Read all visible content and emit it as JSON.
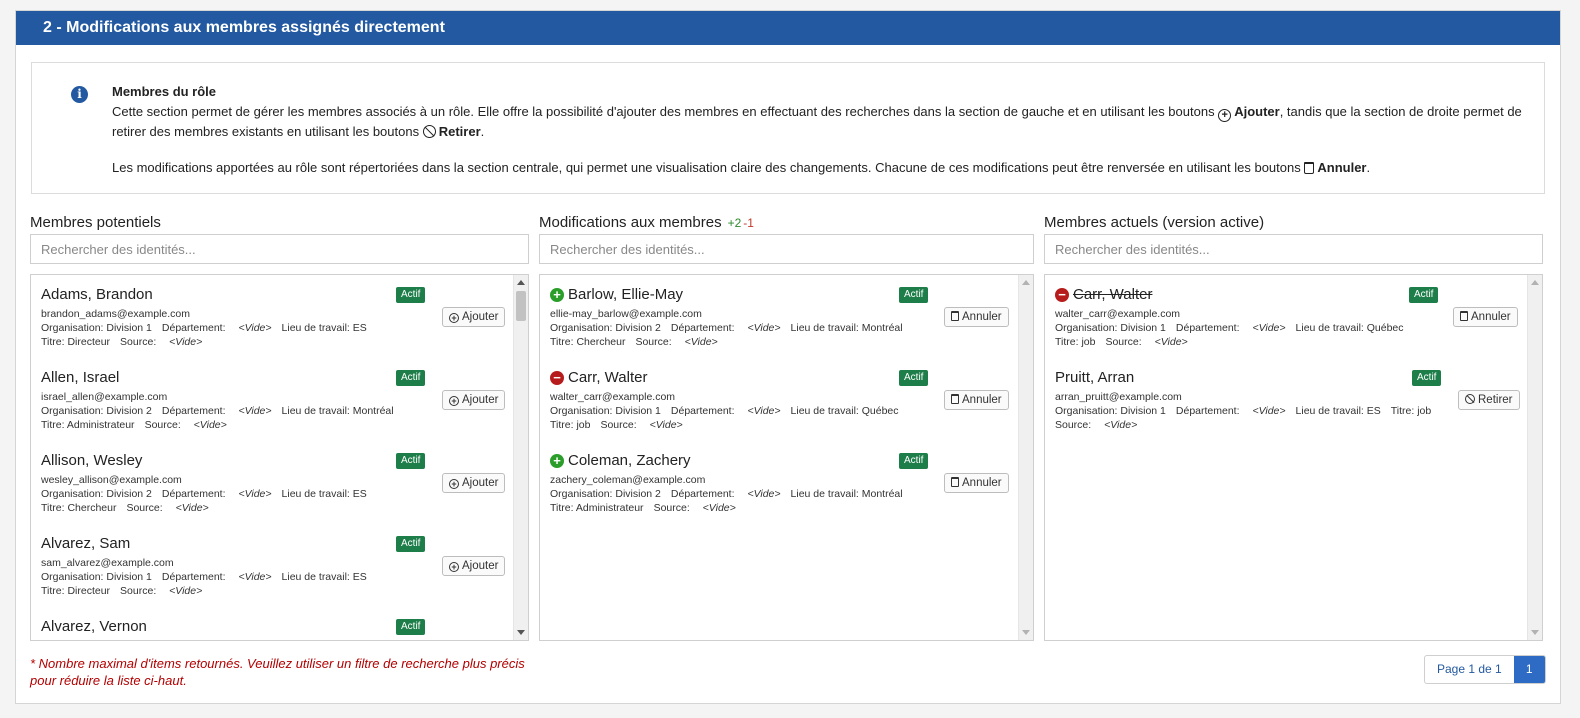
{
  "section": {
    "title": "2 - Modifications aux membres assignés directement"
  },
  "info": {
    "icon": "info-circle-icon",
    "title": "Membres du rôle",
    "p1_a": "Cette section permet de gérer les membres associés à un rôle. Elle offre la possibilité d'ajouter des membres en effectuant des recherches dans la section de gauche et en utilisant les boutons",
    "p1_add": "Ajouter",
    "p1_b": ", tandis que la section de droite permet de retirer des membres existants en utilisant les boutons",
    "p1_remove": "Retirer",
    "p1_c": ".",
    "p2_a": "Les modifications apportées au rôle sont répertoriées dans la section centrale, qui permet une visualisation claire des changements. Chacune de ces modifications peut être renversée en utilisant les boutons",
    "p2_cancel": "Annuler",
    "p2_b": "."
  },
  "columns": {
    "potential": {
      "title": "Membres potentiels",
      "search_placeholder": "Rechercher des identités...",
      "items": [
        {
          "name": "Adams, Brandon",
          "status": "Actif",
          "email": "brandon_adams@example.com",
          "org": "Organisation: Division 1",
          "dept": "Département:",
          "dept_val": "<Vide>",
          "place": "Lieu de travail: ES",
          "title": "Titre: Directeur",
          "source": "Source:",
          "source_val": "<Vide>",
          "button": "Ajouter"
        },
        {
          "name": "Allen, Israel",
          "status": "Actif",
          "email": "israel_allen@example.com",
          "org": "Organisation: Division 2",
          "dept": "Département:",
          "dept_val": "<Vide>",
          "place": "Lieu de travail: Montréal",
          "title": "Titre: Administrateur",
          "source": "Source:",
          "source_val": "<Vide>",
          "button": "Ajouter"
        },
        {
          "name": "Allison, Wesley",
          "status": "Actif",
          "email": "wesley_allison@example.com",
          "org": "Organisation: Division 2",
          "dept": "Département:",
          "dept_val": "<Vide>",
          "place": "Lieu de travail: ES",
          "title": "Titre: Chercheur",
          "source": "Source:",
          "source_val": "<Vide>",
          "button": "Ajouter"
        },
        {
          "name": "Alvarez, Sam",
          "status": "Actif",
          "email": "sam_alvarez@example.com",
          "org": "Organisation: Division 1",
          "dept": "Département:",
          "dept_val": "<Vide>",
          "place": "Lieu de travail: ES",
          "title": "Titre: Directeur",
          "source": "Source:",
          "source_val": "<Vide>",
          "button": "Ajouter"
        },
        {
          "name": "Alvarez, Vernon",
          "status": "Actif"
        }
      ]
    },
    "changes": {
      "title": "Modifications aux membres",
      "added": "+2",
      "removed": "-1",
      "search_placeholder": "Rechercher des identités...",
      "items": [
        {
          "change": "add",
          "name": "Barlow, Ellie-May",
          "status": "Actif",
          "email": "ellie-may_barlow@example.com",
          "org": "Organisation: Division 2",
          "dept": "Département:",
          "dept_val": "<Vide>",
          "place": "Lieu de travail: Montréal",
          "title": "Titre: Chercheur",
          "source": "Source:",
          "source_val": "<Vide>",
          "button": "Annuler"
        },
        {
          "change": "remove",
          "name": "Carr, Walter",
          "status": "Actif",
          "email": "walter_carr@example.com",
          "org": "Organisation: Division 1",
          "dept": "Département:",
          "dept_val": "<Vide>",
          "place": "Lieu de travail: Québec",
          "title": "Titre: job",
          "source": "Source:",
          "source_val": "<Vide>",
          "button": "Annuler"
        },
        {
          "change": "add",
          "name": "Coleman, Zachery",
          "status": "Actif",
          "email": "zachery_coleman@example.com",
          "org": "Organisation: Division 2",
          "dept": "Département:",
          "dept_val": "<Vide>",
          "place": "Lieu de travail: Montréal",
          "title": "Titre: Administrateur",
          "source": "Source:",
          "source_val": "<Vide>",
          "button": "Annuler"
        }
      ]
    },
    "current": {
      "title": "Membres actuels (version active)",
      "search_placeholder": "Rechercher des identités...",
      "items": [
        {
          "change": "remove",
          "name": "Carr, Walter",
          "status": "Actif",
          "email": "walter_carr@example.com",
          "org": "Organisation: Division 1",
          "dept": "Département:",
          "dept_val": "<Vide>",
          "place": "Lieu de travail: Québec",
          "title": "Titre: job",
          "source": "Source:",
          "source_val": "<Vide>",
          "button": "Annuler"
        },
        {
          "name": "Pruitt, Arran",
          "status": "Actif",
          "email": "arran_pruitt@example.com",
          "org": "Organisation: Division 1",
          "dept": "Département:",
          "dept_val": "<Vide>",
          "place": "Lieu de travail: ES",
          "title_inline": "Titre: job",
          "source": "Source:",
          "source_val": "<Vide>",
          "button": "Retirer"
        }
      ]
    }
  },
  "footer": {
    "note_line1": "* Nombre maximal d'items retournés. Veuillez utiliser un filtre de recherche plus précis",
    "note_line2": "pour réduire la liste ci-haut.",
    "page_label": "Page 1 de 1",
    "page_current": "1"
  },
  "colors": {
    "header": "#2359a0",
    "badge": "#1e7e4a",
    "add": "#2a9d2a",
    "remove": "#b71c1c",
    "note": "#b30000"
  }
}
